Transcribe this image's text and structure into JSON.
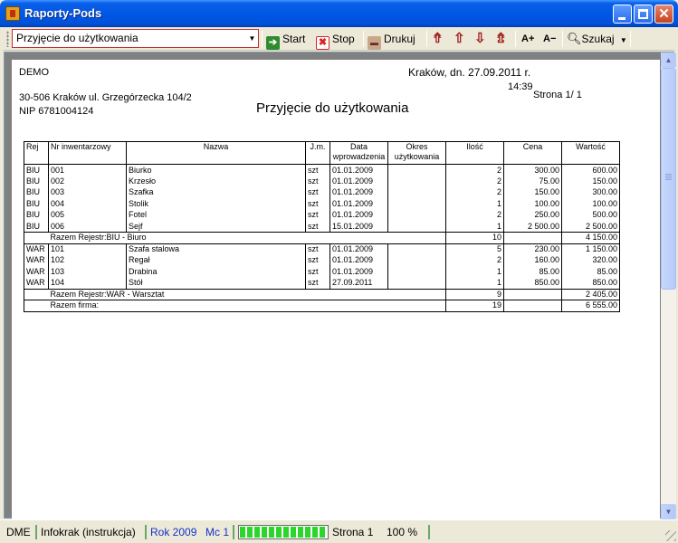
{
  "window": {
    "title": "Raporty-Pods"
  },
  "toolbar": {
    "report_value": "Przyjęcie do użytkowania",
    "start": "Start",
    "stop": "Stop",
    "print": "Drukuj",
    "font_up": "A+",
    "font_down": "A−",
    "search": "Szukaj"
  },
  "report": {
    "company": "DEMO",
    "address": "30-506 Kraków  ul. Grzegórzecka 104/2",
    "nip": "NIP  6781004124",
    "place_date": "Kraków,  dn.  27.09.2011  r.",
    "time": "14:39",
    "page": "Strona 1/  1",
    "title": "Przyjęcie do użytkowania",
    "headers": [
      "Rej",
      "Nr inwentarzowy",
      "Nazwa",
      "J.m.",
      "Data wprowadzenia",
      "Okres użytkowania",
      "Ilość",
      "Cena",
      "Wartość"
    ],
    "groups": [
      {
        "rows": [
          [
            "BIU",
            "001",
            "Biurko",
            "szt",
            "01.01.2009",
            "",
            "2",
            "300.00",
            "600.00"
          ],
          [
            "BIU",
            "002",
            "Krzesło",
            "szt",
            "01.01.2009",
            "",
            "2",
            "75.00",
            "150.00"
          ],
          [
            "BIU",
            "003",
            "Szafka",
            "szt",
            "01.01.2009",
            "",
            "2",
            "150.00",
            "300.00"
          ],
          [
            "BIU",
            "004",
            "Stolik",
            "szt",
            "01.01.2009",
            "",
            "1",
            "100.00",
            "100.00"
          ],
          [
            "BIU",
            "005",
            "Fotel",
            "szt",
            "01.01.2009",
            "",
            "2",
            "250.00",
            "500.00"
          ],
          [
            "BIU",
            "006",
            "Sejf",
            "szt",
            "15.01.2009",
            "",
            "1",
            "2 500.00",
            "2 500.00"
          ]
        ],
        "subtotal": {
          "label": "Razem Rejestr:BIU - Biuro",
          "qty": "10",
          "value": "4 150.00"
        }
      },
      {
        "rows": [
          [
            "WAR",
            "101",
            "Szafa stalowa",
            "szt",
            "01.01.2009",
            "",
            "5",
            "230.00",
            "1 150.00"
          ],
          [
            "WAR",
            "102",
            "Regał",
            "szt",
            "01.01.2009",
            "",
            "2",
            "160.00",
            "320.00"
          ],
          [
            "WAR",
            "103",
            "Drabina",
            "szt",
            "01.01.2009",
            "",
            "1",
            "85.00",
            "85.00"
          ],
          [
            "WAR",
            "104",
            "Stół",
            "szt",
            "27.09.2011",
            "",
            "1",
            "850.00",
            "850.00"
          ]
        ],
        "subtotal": {
          "label": "Razem Rejestr:WAR - Warsztat",
          "qty": "9",
          "value": "2 405.00"
        }
      }
    ],
    "total": {
      "label": "Razem firma:",
      "qty": "19",
      "value": "6 555.00"
    }
  },
  "status": {
    "code": "DME",
    "company": "Infokrak (instrukcja)",
    "year": "Rok 2009",
    "month": "Mc 1",
    "progress_percent": 100,
    "page_label": "Strona 1",
    "zoom": "100 %"
  }
}
